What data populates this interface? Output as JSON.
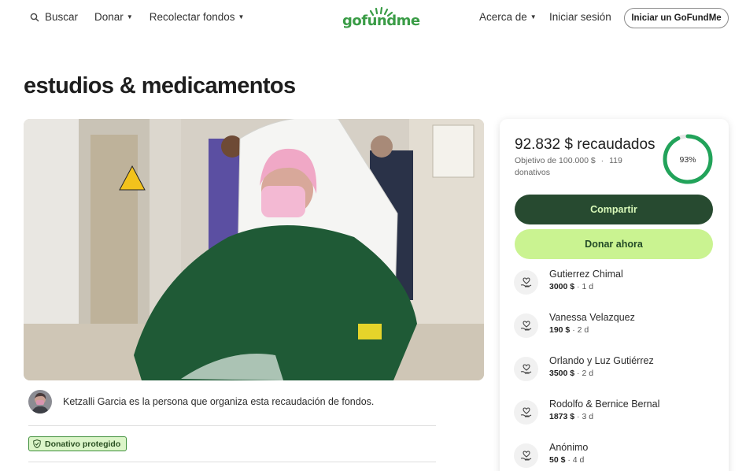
{
  "header": {
    "search_label": "Buscar",
    "donate_label": "Donar",
    "fundraise_label": "Recolectar fondos",
    "logo_text": "gofundme",
    "about_label": "Acerca de",
    "login_label": "Iniciar sesión",
    "start_label": "Iniciar un GoFundMe",
    "brand_color": "#3a9c46"
  },
  "campaign": {
    "title": "estudios & medicamentos",
    "organizer_text": "Ketzalli Garcia es la persona que organiza esta recaudación de fondos.",
    "protected_label": "Donativo protegido"
  },
  "card": {
    "raised_text": "92.832 $ recaudados",
    "goal_text": "Objetivo de 100.000 $",
    "separator": "·",
    "donations_text": "119 donativos",
    "percent_text": "93%",
    "percent_value": 0.93,
    "share_label": "Compartir",
    "donate_label": "Donar ahora",
    "donors": [
      {
        "name": "Gutierrez Chimal",
        "amount": "3000 $",
        "time": "1 d"
      },
      {
        "name": "Vanessa Velazquez",
        "amount": "190 $",
        "time": "2 d"
      },
      {
        "name": "Orlando y Luz Gutiérrez",
        "amount": "3500 $",
        "time": "2 d"
      },
      {
        "name": "Rodolfo & Bernice Bernal",
        "amount": "1873 $",
        "time": "3 d"
      },
      {
        "name": "Anónimo",
        "amount": "50 $",
        "time": "4 d"
      }
    ]
  }
}
